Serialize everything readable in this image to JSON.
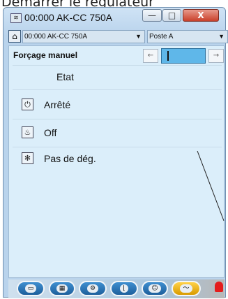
{
  "caption": "Démarrer le régulateur",
  "window": {
    "title": "00:000 AK-CC 750A",
    "app_icon": "signal-icon",
    "btn_min": "—",
    "btn_max": "□",
    "btn_close": "X"
  },
  "toolbar": {
    "home_icon": "home-icon",
    "device_select": "00:000 AK-CC 750A",
    "poste_select": "Poste A"
  },
  "panel": {
    "title": "Forçage manuel",
    "prev_glyph": "←",
    "next_glyph": "→",
    "value": "",
    "etat_label": "Etat",
    "rows": [
      {
        "icon": "power-icon",
        "glyph": "⏻",
        "label": "Arrêté"
      },
      {
        "icon": "fan-off-icon",
        "glyph": "♨",
        "label": "Off"
      },
      {
        "icon": "defrost-icon",
        "glyph": "✻",
        "label": "Pas de dég."
      }
    ]
  },
  "statusbar": {
    "tabs": [
      {
        "icon": "device-icon",
        "glyph": "▭"
      },
      {
        "icon": "grid-icon",
        "glyph": "▦"
      },
      {
        "icon": "tools-icon",
        "glyph": "⚙"
      },
      {
        "icon": "chart-icon",
        "glyph": "⌊"
      },
      {
        "icon": "user-icon",
        "glyph": "☺"
      },
      {
        "icon": "curve-icon",
        "glyph": "〜"
      }
    ],
    "alarm_icon": "alarm-bell-icon",
    "accent_active": "#e6a800",
    "accent_alarm": "#e41c1c"
  }
}
